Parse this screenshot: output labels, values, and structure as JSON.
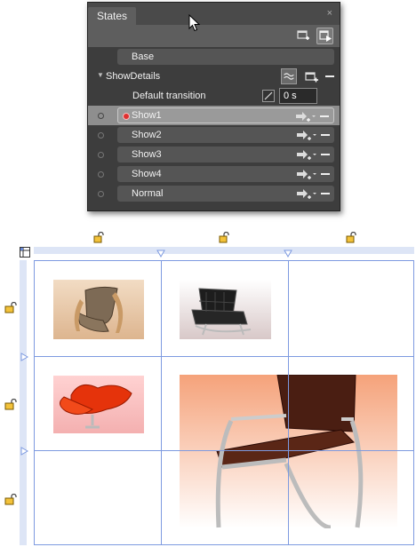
{
  "states_panel": {
    "title": "States",
    "close_glyph": "×",
    "toolbar_icons": [
      "add-state-group-icon",
      "transition-preview-icon"
    ],
    "base_label": "Base",
    "group": {
      "name": "ShowDetails",
      "default_transition_label": "Default transition",
      "duration_value": "0 s",
      "states": [
        {
          "label": "Show1",
          "selected": true,
          "recording": true
        },
        {
          "label": "Show2"
        },
        {
          "label": "Show3"
        },
        {
          "label": "Show4"
        },
        {
          "label": "Normal"
        }
      ]
    }
  },
  "design_surface": {
    "images": [
      {
        "icon": "woven-lounge-chair-icon"
      },
      {
        "icon": "black-leather-chair-icon"
      },
      {
        "icon": "red-swan-chair-icon"
      },
      {
        "icon": "brown-sling-chair-icon"
      }
    ],
    "colors": {
      "grid_line": "#7d9ae0",
      "ruler": "#dde5f6",
      "panel_bg": "#3d3d3d",
      "selected_row": "#8e8e8e"
    }
  }
}
